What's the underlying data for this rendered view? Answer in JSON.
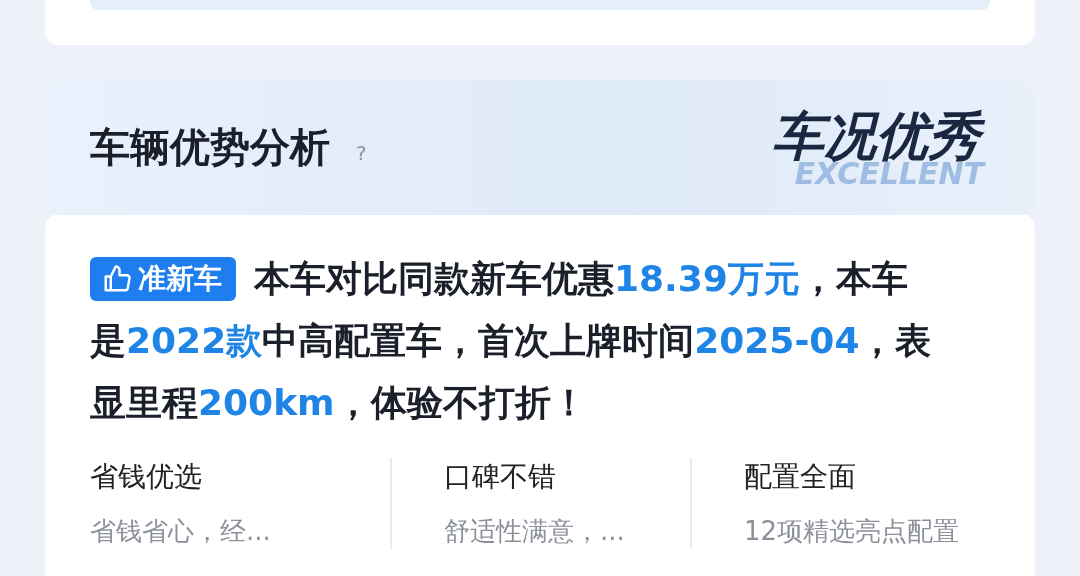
{
  "section": {
    "title": "车辆优势分析",
    "help": "?",
    "grade": "车况优秀",
    "grade_backdrop": "EXCELLENT"
  },
  "summary": {
    "badge": "准新车",
    "lines": [
      {
        "segments": [
          {
            "text": "本车对比同款新车优惠",
            "highlight": false
          },
          {
            "text": "18.39万元",
            "highlight": true
          },
          {
            "text": "，本车",
            "highlight": false
          }
        ]
      },
      {
        "segments": [
          {
            "text": "是",
            "highlight": false
          },
          {
            "text": "2022款",
            "highlight": true
          },
          {
            "text": "中高配置车，首次上牌时间",
            "highlight": false
          },
          {
            "text": "2025-04",
            "highlight": true
          },
          {
            "text": "，表",
            "highlight": false
          }
        ]
      },
      {
        "segments": [
          {
            "text": "显里程",
            "highlight": false
          },
          {
            "text": "200km",
            "highlight": true
          },
          {
            "text": "，体验不打折！",
            "highlight": false
          }
        ]
      }
    ]
  },
  "features": [
    {
      "title": "省钱优选",
      "detail": "省钱省心，经..."
    },
    {
      "title": "口碑不错",
      "detail": "舒适性满意，..."
    },
    {
      "title": "配置全面",
      "detail": "12项精选亮点配置"
    }
  ]
}
